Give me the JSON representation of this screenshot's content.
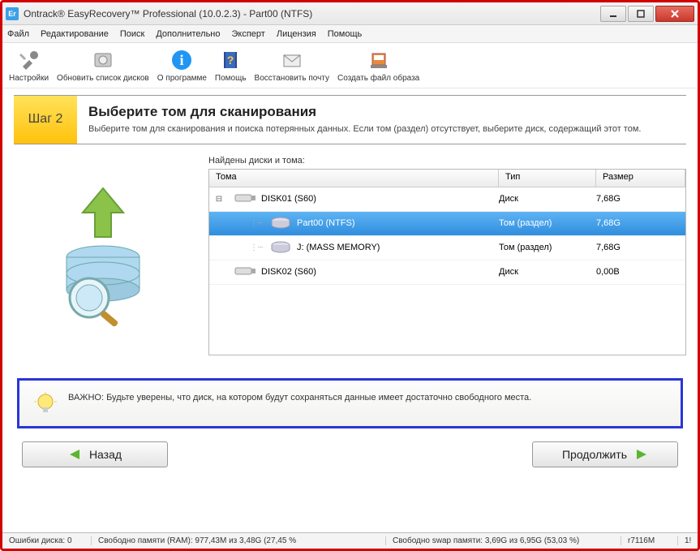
{
  "window": {
    "title": "Ontrack® EasyRecovery™ Professional (10.0.2.3) - Part00 (NTFS)"
  },
  "menu": {
    "file": "Файл",
    "edit": "Редактирование",
    "search": "Поиск",
    "extra": "Дополнительно",
    "expert": "Эксперт",
    "license": "Лицензия",
    "help": "Помощь"
  },
  "toolbar": {
    "settings": "Настройки",
    "refresh": "Обновить список дисков",
    "about": "О программе",
    "help": "Помощь",
    "mail": "Восстановить почту",
    "image": "Создать файл образа"
  },
  "step": {
    "badge": "Шаг 2",
    "title": "Выберите том для сканирования",
    "desc": "Выберите том для сканирования и поиска потерянных данных. Если том (раздел) отсутствует, выберите диск, содержащий этот том."
  },
  "disks": {
    "found_label": "Найдены диски и тома:",
    "columns": {
      "c1": "Тома",
      "c2": "Тип",
      "c3": "Размер"
    },
    "rows": [
      {
        "name": "DISK01 (S60)",
        "type": "Диск",
        "size": "7,68G",
        "icon": "usb",
        "lvl": 0,
        "exp": "⊟"
      },
      {
        "name": "Part00 (NTFS)",
        "type": "Том (раздел)",
        "size": "7,68G",
        "icon": "vol",
        "lvl": 1,
        "selected": true
      },
      {
        "name": "J: (MASS MEMORY)",
        "type": "Том (раздел)",
        "size": "7,68G",
        "icon": "vol",
        "lvl": 1
      },
      {
        "name": "DISK02 (S60)",
        "type": "Диск",
        "size": "0,00B",
        "icon": "usb",
        "lvl": 0
      }
    ]
  },
  "tip": {
    "text": "ВАЖНО: Будьте уверены, что диск, на котором будут сохраняться данные имеет достаточно свободного места."
  },
  "nav": {
    "back": "Назад",
    "next": "Продолжить"
  },
  "status": {
    "errors": "Ошибки диска: 0",
    "ram": "Свободно памяти (RAM): 977,43M из 3,48G (27,45 %",
    "swap": "Свободно swap памяти: 3,69G из 6,95G (53,03 %)",
    "host": "r7116M",
    "last": "1!"
  }
}
